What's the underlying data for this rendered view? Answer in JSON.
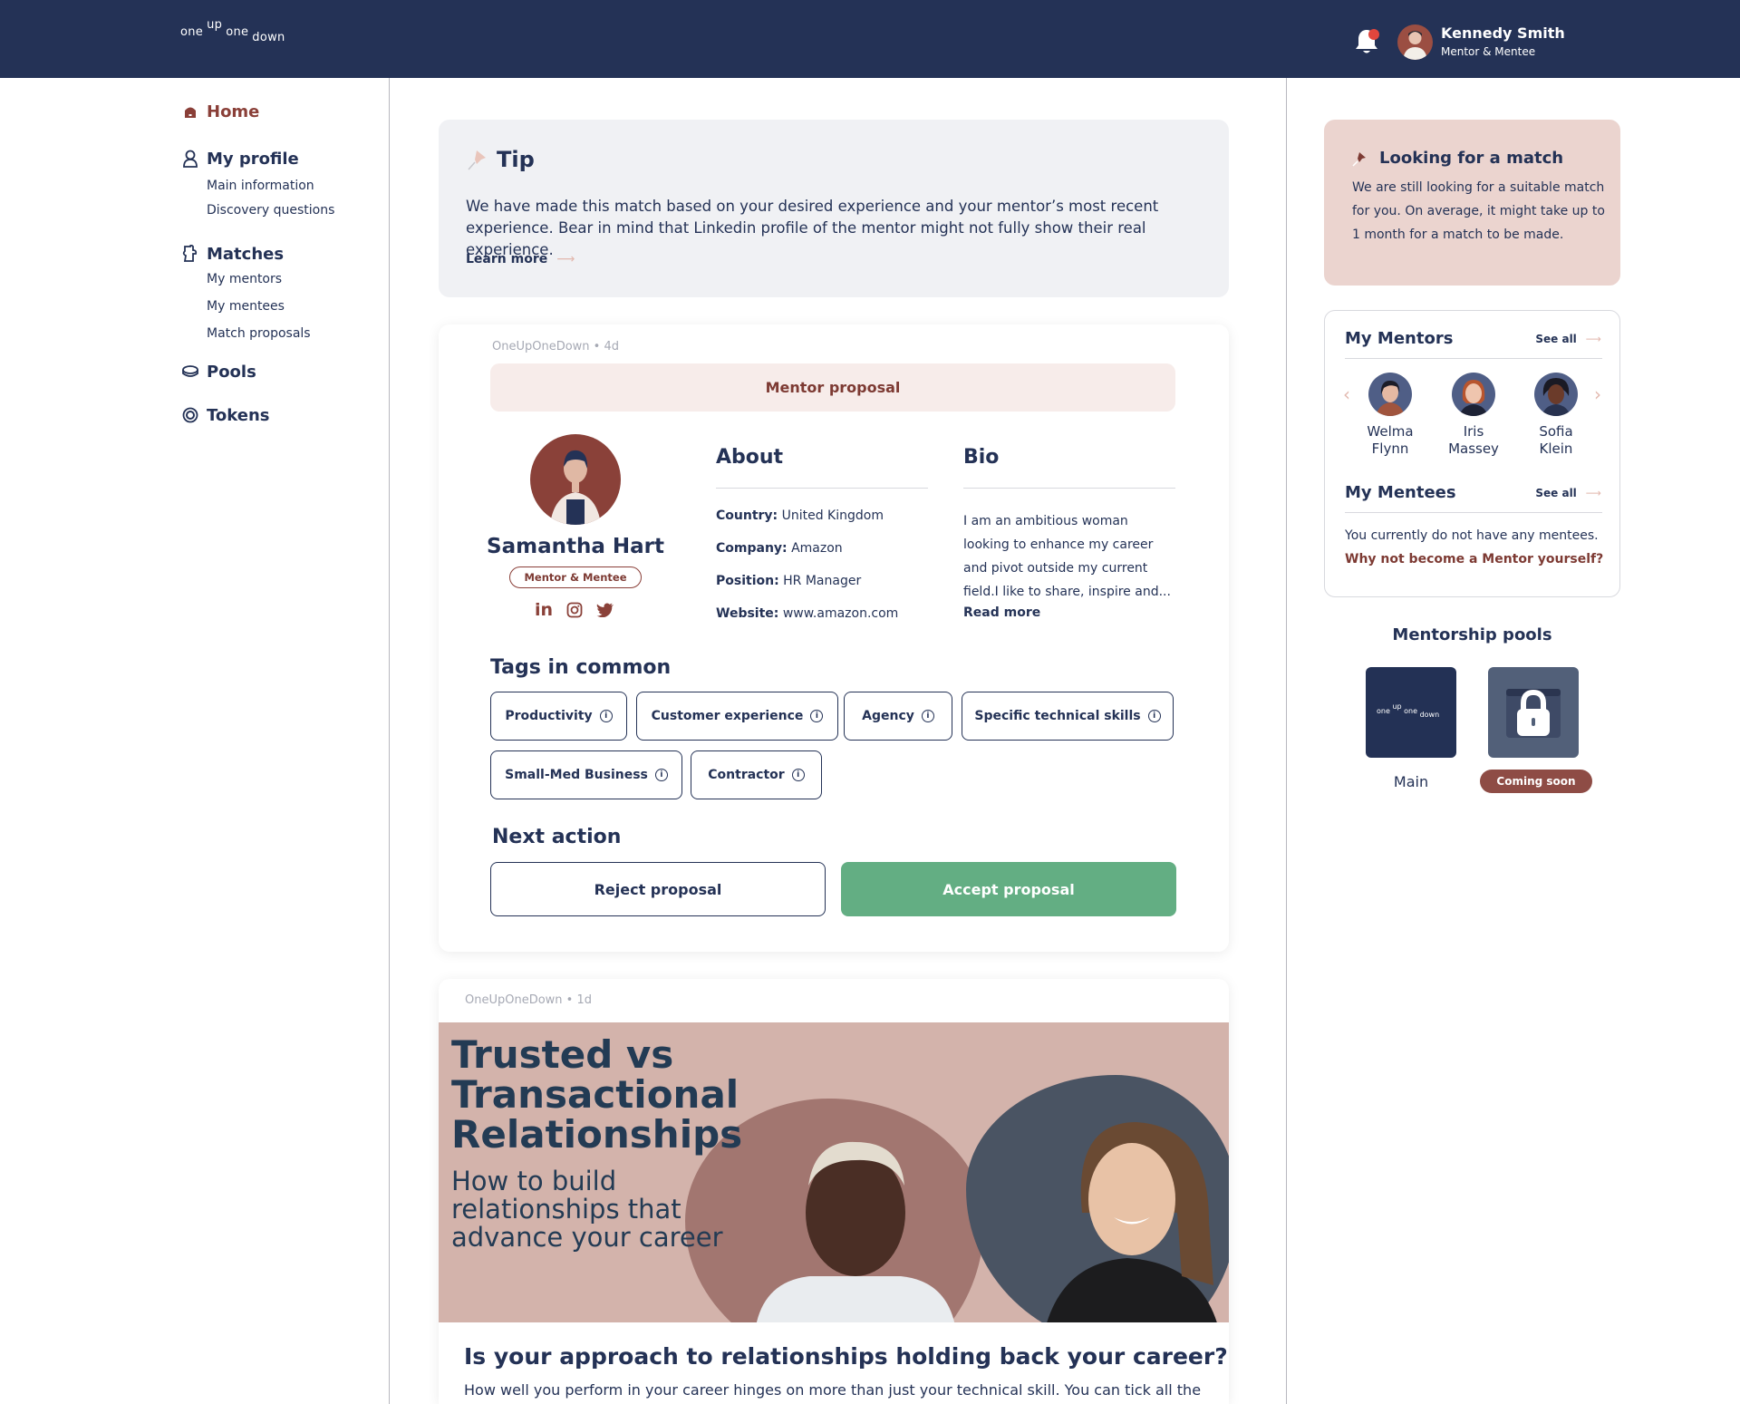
{
  "header": {
    "logo": {
      "w1": "one",
      "w2": "up",
      "w3": "one",
      "w4": "down"
    },
    "user": {
      "name": "Kennedy Smith",
      "role": "Mentor & Mentee"
    },
    "notifications_unread": true
  },
  "sidebar": {
    "items": [
      {
        "label": "Home",
        "icon": "home-icon",
        "active": true,
        "children": []
      },
      {
        "label": "My profile",
        "icon": "user-icon",
        "children": [
          "Main information",
          "Discovery questions"
        ]
      },
      {
        "label": "Matches",
        "icon": "puzzle-icon",
        "children": [
          "My mentors",
          "My mentees",
          "Match proposals"
        ]
      },
      {
        "label": "Pools",
        "icon": "pool-icon",
        "children": []
      },
      {
        "label": "Tokens",
        "icon": "token-icon",
        "children": []
      }
    ]
  },
  "tip": {
    "title": "Tip",
    "text": "We have made this match based on your desired experience and your mentor’s most recent experience. Bear in mind that Linkedin profile of the mentor might not fully show their real experience.",
    "link": "Learn more"
  },
  "proposal": {
    "meta": "OneUpOneDown • 4d",
    "banner": "Mentor proposal",
    "name": "Samantha Hart",
    "badge": "Mentor & Mentee",
    "socials": [
      "linkedin",
      "instagram",
      "twitter"
    ],
    "about_title": "About",
    "about": [
      {
        "label": "Country:",
        "value": "United Kingdom"
      },
      {
        "label": "Company:",
        "value": "Amazon"
      },
      {
        "label": "Position:",
        "value": "HR Manager"
      },
      {
        "label": "Website:",
        "value": "www.amazon.com"
      }
    ],
    "bio_title": "Bio",
    "bio": "I am an ambitious woman looking to enhance my career and pivot outside my current field.I like to share, inspire and...",
    "read_more": "Read more",
    "tags_title": "Tags in common",
    "tags": [
      "Productivity",
      "Customer experience",
      "Agency",
      "Specific technical skills",
      "Small-Med Business",
      "Contractor"
    ],
    "next_title": "Next action",
    "reject": "Reject proposal",
    "accept": "Accept proposal"
  },
  "article": {
    "meta": "OneUpOneDown • 1d",
    "image_title_lines": [
      "Trusted vs",
      "Transactional",
      "Relationships"
    ],
    "image_sub_lines": [
      "How to build",
      "relationships that",
      "advance your career"
    ],
    "heading": "Is your approach to relationships holding back your career?",
    "excerpt": "How well you perform in your career hinges on more than just your technical skill. You can tick all the"
  },
  "right": {
    "match": {
      "title": "Looking for a match",
      "text": "We are still looking for a suitable match for you. On average, it might take up to 1 month for a match to be made."
    },
    "mentors": {
      "title": "My Mentors",
      "see_all": "See all",
      "people": [
        {
          "first": "Welma",
          "last": "Flynn"
        },
        {
          "first": "Iris",
          "last": "Massey"
        },
        {
          "first": "Sofia",
          "last": "Klein"
        }
      ]
    },
    "mentees": {
      "title": "My Mentees",
      "see_all": "See all",
      "empty": "You currently do not have any mentees.",
      "cta": "Why not become a Mentor yourself?"
    },
    "pools": {
      "title": "Mentorship pools",
      "main_label": "Main",
      "soon_label": "Coming soon"
    }
  },
  "colors": {
    "navy": "#243256",
    "brand_red": "#8a3f38",
    "accept_green": "#63ae83",
    "tip_bg": "#f0f1f4",
    "match_bg": "#ebd4cf"
  }
}
